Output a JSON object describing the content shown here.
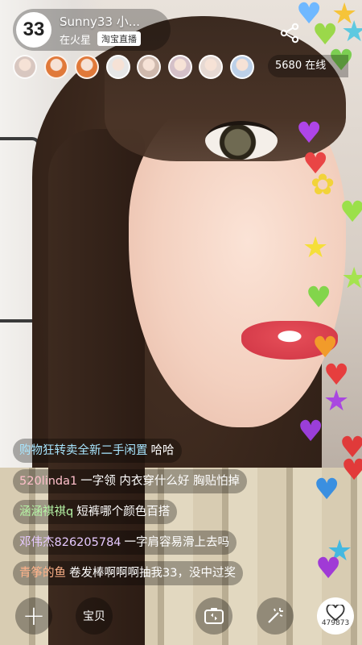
{
  "host": {
    "avatar_text": "33",
    "name": "Sunny33 小...",
    "location": "在火星",
    "badge": "淘宝直播"
  },
  "viewers": {
    "avatar_colors": [
      "#d8c7c0",
      "#e0793a",
      "#e0793a",
      "#e6e6e6",
      "#cfb9ad",
      "#d4c0c8",
      "#e6d9d3",
      "#bcd0e8"
    ],
    "count_text": "5680 在线"
  },
  "chat": [
    {
      "user": "购物狂转卖全新二手闲置",
      "text": "哈哈",
      "user_color": "#a8e6ff"
    },
    {
      "user": "520linda1",
      "text": "一字领 内衣穿什么好 胸贴怕掉",
      "user_color": "#ffc0cb"
    },
    {
      "user": "涵涵祺祺q",
      "text": "短裤哪个颜色百搭",
      "user_color": "#b6f5a6"
    },
    {
      "user": "邓伟杰826205784",
      "text": "一字肩容易滑上去吗",
      "user_color": "#e6c9ff"
    },
    {
      "user": "青筝的鱼",
      "text": "卷发棒啊啊啊抽我33，没中过奖",
      "user_color": "#ffb38a"
    }
  ],
  "toolbar": {
    "add_label": "+",
    "items_label": "宝贝",
    "like_count": "479873"
  },
  "hearts": [
    {
      "color": "#6fb8ff",
      "glyph": "♥"
    },
    {
      "color": "#f6c43a",
      "glyph": "★"
    },
    {
      "color": "#9bd84a",
      "glyph": "♥"
    },
    {
      "color": "#5dc9e0",
      "glyph": "★"
    },
    {
      "color": "#7ccf52",
      "glyph": "♥"
    },
    {
      "color": "#ae45e8",
      "glyph": "♥"
    },
    {
      "color": "#e94545",
      "glyph": "♥"
    },
    {
      "color": "#f2d33a",
      "glyph": "✿"
    },
    {
      "color": "#9be04a",
      "glyph": "♥"
    },
    {
      "color": "#f5df3a",
      "glyph": "★"
    },
    {
      "color": "#a5e34f",
      "glyph": "★"
    },
    {
      "color": "#82d54b",
      "glyph": "♥"
    },
    {
      "color": "#f29b2a",
      "glyph": "♥"
    },
    {
      "color": "#e63e3e",
      "glyph": "♥"
    },
    {
      "color": "#a947e0",
      "glyph": "★"
    },
    {
      "color": "#9a3ed8",
      "glyph": "♥"
    },
    {
      "color": "#e03a3a",
      "glyph": "♥"
    },
    {
      "color": "#3a8fe0",
      "glyph": "♥"
    },
    {
      "color": "#e23a3a",
      "glyph": "♥"
    },
    {
      "color": "#44b8e0",
      "glyph": "★"
    },
    {
      "color": "#a03ad6",
      "glyph": "♥"
    }
  ]
}
